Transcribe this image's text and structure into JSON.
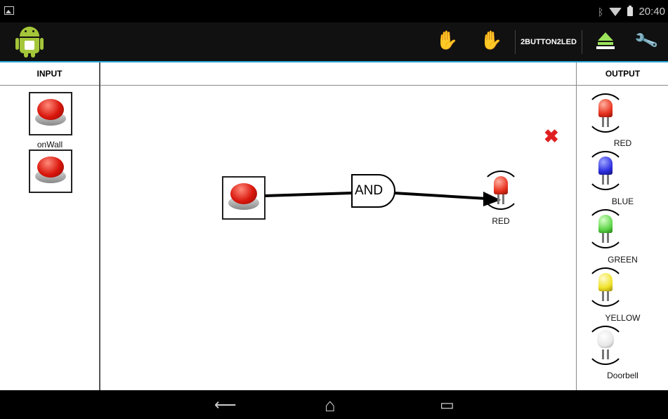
{
  "status_bar": {
    "time": "20:40"
  },
  "action_bar": {
    "project_name": "2BUTTON2LED"
  },
  "input_panel": {
    "header": "INPUT",
    "items": [
      {
        "label": "onWall"
      },
      {
        "label": ""
      }
    ]
  },
  "output_panel": {
    "header": "OUTPUT",
    "items": [
      {
        "label": "RED",
        "color": "#e8321e"
      },
      {
        "label": "BLUE",
        "color": "#2d2ee0"
      },
      {
        "label": "GREEN",
        "color": "#5fd64a"
      },
      {
        "label": "YELLOW",
        "color": "#f0e227"
      },
      {
        "label": "Doorbell",
        "color": "#e8e8e8"
      }
    ]
  },
  "canvas": {
    "gate_label": "AND",
    "output_label": "RED",
    "output_color": "#e8321e"
  },
  "colors": {
    "accent": "#2aa4d6",
    "close": "#e02020"
  }
}
